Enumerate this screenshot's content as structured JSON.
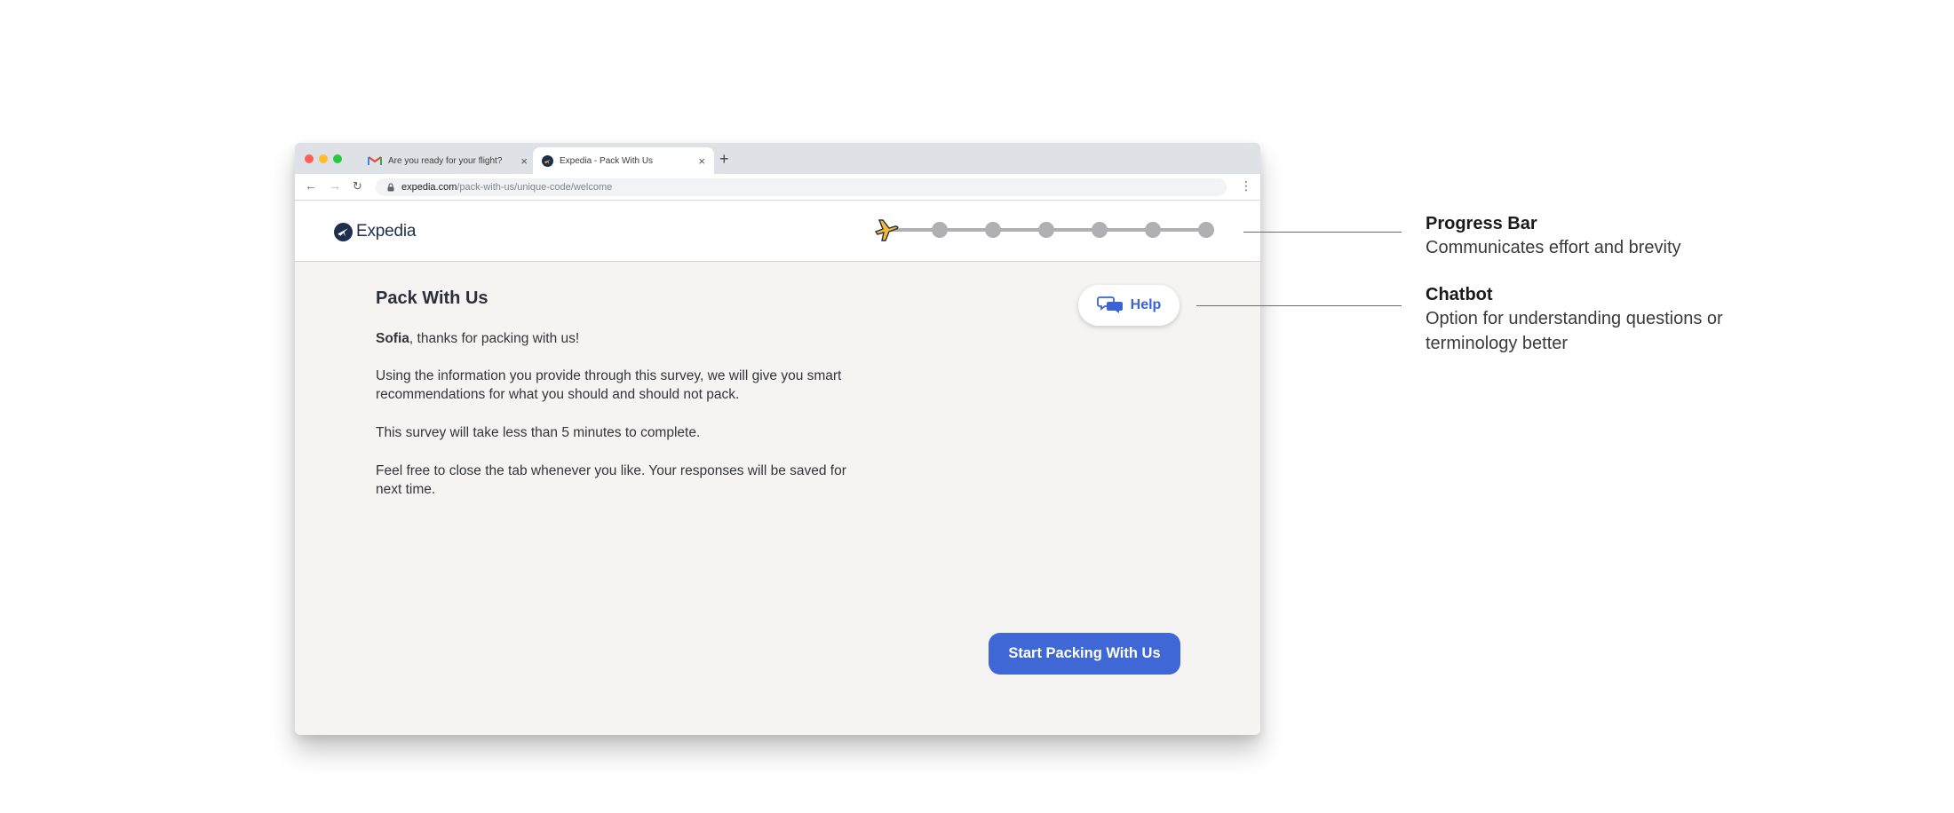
{
  "browser": {
    "tabs": [
      {
        "title": "Are you ready for your flight?",
        "icon": "gmail-icon"
      },
      {
        "title": "Expedia - Pack With Us",
        "icon": "expedia-favicon",
        "active": true
      }
    ],
    "url_host": "expedia.com",
    "url_path": "/pack-with-us/unique-code/welcome"
  },
  "header": {
    "brand": "Expedia",
    "progress": {
      "total_steps": 7,
      "current_step": 1
    }
  },
  "main": {
    "title": "Pack With Us",
    "greeting_name": "Sofia",
    "greeting_rest": ", thanks for packing with us!",
    "paragraph_2": "Using the information you provide through this survey, we will give you smart recommendations for what you should and should not pack.",
    "paragraph_3": "This survey will take less than 5 minutes to complete.",
    "paragraph_4": "Feel free to close the tab whenever you like. Your responses will be saved for next time.",
    "help_label": "Help",
    "start_label": "Start Packing With Us"
  },
  "annotations": [
    {
      "title": "Progress Bar",
      "description": "Communicates effort and brevity"
    },
    {
      "title": "Chatbot",
      "description": "Option for understanding questions or terminology better"
    }
  ],
  "colors": {
    "accent": "#3f67d6",
    "brand_navy": "#1d2e4e",
    "plane": "#f5b830",
    "progress_gray": "#b0b0b3",
    "page_bg": "#f5f4f3"
  }
}
